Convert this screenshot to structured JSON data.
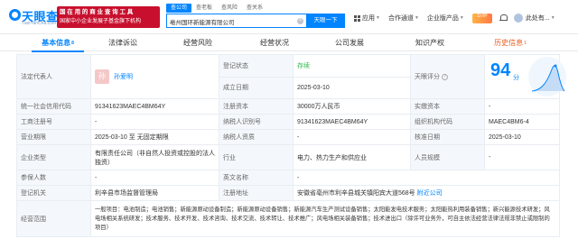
{
  "brand": {
    "name": "天眼查",
    "subtitle": "TianYanCha.com"
  },
  "ad": {
    "line1": "国 在 用 的 商 业 查 询 工 具",
    "line2": "国家中小企业发展子基金旗下机构"
  },
  "search": {
    "tabs": [
      "查公司",
      "查老板",
      "查风险",
      "查关系"
    ],
    "active_tab": 0,
    "value": "亳州国环新能源有限公司",
    "button": "天眼一下"
  },
  "top_nav": {
    "app": "应用",
    "cooperation": "合作通道",
    "enterprise": "企业版产品",
    "vip_badge": "SVIP",
    "user": "此处有..."
  },
  "tabs": [
    {
      "label": "基本信息",
      "count": "8"
    },
    {
      "label": "法律诉讼",
      "count": ""
    },
    {
      "label": "经营风险",
      "count": ""
    },
    {
      "label": "经营状况",
      "count": ""
    },
    {
      "label": "公司发展",
      "count": ""
    },
    {
      "label": "知识产权",
      "count": ""
    },
    {
      "label": "历史信息",
      "count": "1"
    }
  ],
  "info": {
    "legal_rep_label": "法定代表人",
    "legal_rep_avatar": "孙",
    "legal_rep_name": "孙爱明",
    "status_label": "登记状态",
    "status_value": "存续",
    "score_label": "天眼评分",
    "score_value": "94",
    "score_unit": "分",
    "established_label": "成立日期",
    "established_value": "2025-03-10",
    "credit_code_label": "统一社会信用代码",
    "credit_code_value": "91341623MAEC4BM64Y",
    "reg_capital_label": "注册资本",
    "reg_capital_value": "30000万人民币",
    "paid_capital_label": "实缴资本",
    "paid_capital_value": "-",
    "biz_reg_no_label": "工商注册号",
    "biz_reg_no_value": "-",
    "tax_no_label": "纳税人识别号",
    "tax_no_value": "91341623MAEC4BM64Y",
    "org_code_label": "组织机构代码",
    "org_code_value": "MAEC4BM6-4",
    "term_label": "营业期限",
    "term_value": "2025-03-10 至 无固定期限",
    "taxpayer_q_label": "纳税人资质",
    "taxpayer_q_value": "-",
    "approval_label": "核准日期",
    "approval_value": "2025-03-10",
    "type_label": "企业类型",
    "type_value": "有限责任公司（非自然人投资或控股的法人独资）",
    "industry_label": "行业",
    "industry_value": "电力、热力生产和供应业",
    "staff_label": "人员规模",
    "staff_value": "-",
    "insured_label": "参保人数",
    "insured_value": "-",
    "en_name_label": "英文名称",
    "en_name_value": "-",
    "authority_label": "登记机关",
    "authority_value": "利辛县市场监督管理局",
    "address_label": "注册地址",
    "address_value": "安徽省亳州市利辛县城关镇阳宾大道568号",
    "address_link": "附近公司",
    "scope_label": "经营范围",
    "scope_value": "一般项目：电池制造；电池销售；新能源原动设备制造；新能源原动设备销售；新能源汽车生产测试设备销售；太阳能发电技术服务；太阳能热利用装备销售；新兴能源技术研发；风电场相关系统研发；技术服务、技术开发、技术咨询、技术交流、技术转让、技术推广；风电场相关装备销售；技术进出口（除许可业务外，可自主依法经营法律法规非禁止或限制的项目）"
  },
  "colors": {
    "brand_blue": "#0084ff",
    "ad_red": "#c8102e",
    "status_green": "#2db84d",
    "history_orange": "#e85a1c"
  }
}
